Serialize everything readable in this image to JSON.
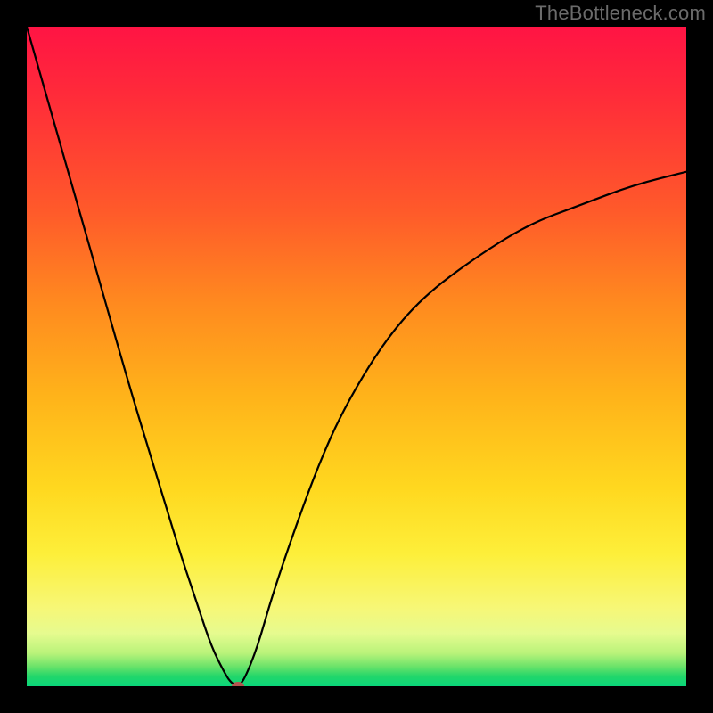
{
  "watermark": "TheBottleneck.com",
  "chart_data": {
    "type": "line",
    "title": "",
    "xlabel": "",
    "ylabel": "",
    "xrange": [
      0,
      100
    ],
    "yrange": [
      0,
      100
    ],
    "grid": false,
    "legend": false,
    "background": {
      "kind": "vertical-gradient",
      "stops": [
        {
          "pos": 0,
          "color": "#ff1444"
        },
        {
          "pos": 0.28,
          "color": "#ff5a2a"
        },
        {
          "pos": 0.56,
          "color": "#ffb31a"
        },
        {
          "pos": 0.8,
          "color": "#fdef3a"
        },
        {
          "pos": 0.95,
          "color": "#b9f37a"
        },
        {
          "pos": 1.0,
          "color": "#0ad67a"
        }
      ]
    },
    "series": [
      {
        "name": "bottleneck-curve",
        "color": "#000000",
        "stroke_width": 2.2,
        "x": [
          0,
          4,
          8,
          12,
          16,
          20,
          23,
          26,
          28,
          30,
          31,
          32,
          33,
          35,
          37,
          40,
          44,
          48,
          54,
          60,
          68,
          76,
          84,
          92,
          100
        ],
        "y": [
          100,
          86,
          72,
          58,
          44,
          31,
          21,
          12,
          6,
          2,
          0.5,
          0,
          1,
          6,
          13,
          22,
          33,
          42,
          52,
          59,
          65,
          70,
          73,
          76,
          78
        ]
      }
    ],
    "annotations": [
      {
        "name": "min-marker",
        "kind": "dot",
        "x": 32,
        "y": 0,
        "color": "#b4554f"
      }
    ]
  }
}
